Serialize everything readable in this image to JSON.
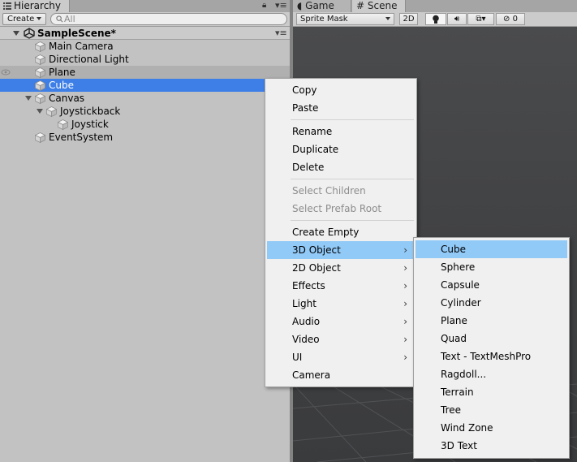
{
  "hierarchy": {
    "tab_label": "Hierarchy",
    "create_label": "Create",
    "search_placeholder": "All",
    "scene_name": "SampleScene*",
    "items": [
      {
        "label": "Main Camera"
      },
      {
        "label": "Directional Light"
      },
      {
        "label": "Plane"
      },
      {
        "label": "Cube"
      },
      {
        "label": "Canvas"
      },
      {
        "label": "Joystickback"
      },
      {
        "label": "Joystick"
      },
      {
        "label": "EventSystem"
      }
    ]
  },
  "scene_view": {
    "tabs": [
      {
        "label": "Game"
      },
      {
        "label": "Scene"
      }
    ],
    "toolbar": {
      "draw_mode": "Sprite Mask",
      "mode_2d": "2D",
      "hidden_count": "0"
    }
  },
  "context_menu": {
    "items": [
      {
        "label": "Copy"
      },
      {
        "label": "Paste"
      },
      {
        "label": "Rename"
      },
      {
        "label": "Duplicate"
      },
      {
        "label": "Delete"
      },
      {
        "label": "Select Children"
      },
      {
        "label": "Select Prefab Root"
      },
      {
        "label": "Create Empty"
      },
      {
        "label": "3D Object"
      },
      {
        "label": "2D Object"
      },
      {
        "label": "Effects"
      },
      {
        "label": "Light"
      },
      {
        "label": "Audio"
      },
      {
        "label": "Video"
      },
      {
        "label": "UI"
      },
      {
        "label": "Camera"
      }
    ],
    "submenu_arrow": "›"
  },
  "submenu_3d": {
    "items": [
      {
        "label": "Cube"
      },
      {
        "label": "Sphere"
      },
      {
        "label": "Capsule"
      },
      {
        "label": "Cylinder"
      },
      {
        "label": "Plane"
      },
      {
        "label": "Quad"
      },
      {
        "label": "Text - TextMeshPro"
      },
      {
        "label": "Ragdoll..."
      },
      {
        "label": "Terrain"
      },
      {
        "label": "Tree"
      },
      {
        "label": "Wind Zone"
      },
      {
        "label": "3D Text"
      }
    ]
  },
  "colors": {
    "selection": "#3d7fe6",
    "menu_highlight": "#91c9f7",
    "panel_bg": "#c2c2c2",
    "viewport_bg": "#454648"
  }
}
